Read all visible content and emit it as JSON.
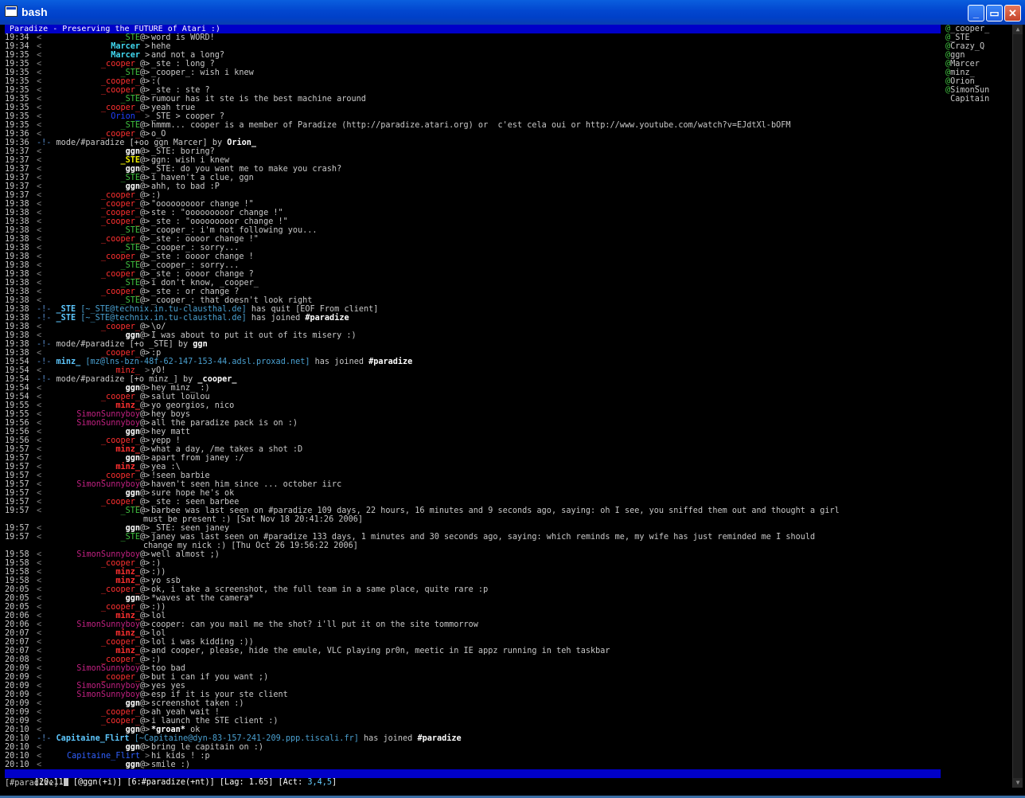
{
  "window": {
    "title": "bash",
    "minimize": "_",
    "maximize": "▭",
    "close": "✕"
  },
  "colors": {
    "titlebar": "#0348d0",
    "topic_bg": "#0000c8",
    "text": "#c8c8c8",
    "nick_red": "#ff3030",
    "nick_green": "#40c040",
    "nick_cyan": "#40d8f0",
    "nick_white": "#ffffff",
    "nick_yellow": "#f0f000",
    "nick_blue": "#3060ff",
    "nick_pink": "#c02080",
    "nick_orion": "#2040ff"
  },
  "topic": " Paradize - Preserving the FUTURE of Atari :)",
  "users": [
    {
      "prefix": "@",
      "name": "_cooper_"
    },
    {
      "prefix": "@",
      "name": "_STE"
    },
    {
      "prefix": "@",
      "name": "Crazy_Q"
    },
    {
      "prefix": "@",
      "name": "ggn"
    },
    {
      "prefix": "@",
      "name": "Marcer"
    },
    {
      "prefix": "@",
      "name": "minz_"
    },
    {
      "prefix": "@",
      "name": "Orion_"
    },
    {
      "prefix": "@",
      "name": "SimonSun"
    },
    {
      "prefix": " ",
      "name": "Capitain"
    }
  ],
  "lines": [
    {
      "t": "19:34",
      "nick": "_STE",
      "mode": "@",
      "color": "#40c040",
      "msg": "word is WORD!"
    },
    {
      "t": "19:34",
      "nick": "Marcer",
      "mode": " ",
      "color": "#40d8f0",
      "bold": true,
      "msg": "hehe"
    },
    {
      "t": "19:35",
      "nick": "Marcer",
      "mode": " ",
      "color": "#40d8f0",
      "bold": true,
      "msg": "and not a long?"
    },
    {
      "t": "19:35",
      "nick": "_cooper_",
      "mode": "@",
      "color": "#ff3030",
      "msg": "_ste : long ?"
    },
    {
      "t": "19:35",
      "nick": "_STE",
      "mode": "@",
      "color": "#40c040",
      "msg": "_cooper_: wish i knew"
    },
    {
      "t": "19:35",
      "nick": "_cooper_",
      "mode": "@",
      "color": "#ff3030",
      "msg": ":("
    },
    {
      "t": "19:35",
      "nick": "_cooper_",
      "mode": "@",
      "color": "#ff3030",
      "msg": "_ste : ste ?"
    },
    {
      "t": "19:35",
      "nick": "_STE",
      "mode": "@",
      "color": "#40c040",
      "msg": "rumour has it ste is the best machine around"
    },
    {
      "t": "19:35",
      "nick": "_cooper_",
      "mode": "@",
      "color": "#ff3030",
      "msg": "yeah true"
    },
    {
      "t": "19:35",
      "nick": "Orion_",
      "mode": " ",
      "color": "#2040ff",
      "gt": ">",
      "msg": "_STE > cooper ?"
    },
    {
      "t": "19:35",
      "nick": "_STE",
      "mode": "@",
      "color": "#40c040",
      "msg": "hmmm... cooper is a member of Paradize (http://paradize.atari.org) or  c'est cela oui or http://www.youtube.com/watch?v=EJdtXl-bOFM"
    },
    {
      "t": "19:36",
      "nick": "_cooper_",
      "mode": "@",
      "color": "#ff3030",
      "msg": "o_O"
    },
    {
      "t": "19:36",
      "kind": "mode",
      "text": "mode/#paradize [+oo ggn Marcer] by ",
      "by": "Orion_"
    },
    {
      "t": "19:37",
      "nick": "ggn",
      "mode": "@",
      "color": "#ffffff",
      "bold": true,
      "msg": "_STE: boring?"
    },
    {
      "t": "19:37",
      "nick": "_STE",
      "mode": "@",
      "color": "#f0f000",
      "bold": true,
      "msg": "ggn: wish i knew"
    },
    {
      "t": "19:37",
      "nick": "ggn",
      "mode": "@",
      "color": "#ffffff",
      "bold": true,
      "msg": "_STE: do you want me to make you crash?"
    },
    {
      "t": "19:37",
      "nick": "_STE",
      "mode": "@",
      "color": "#40c040",
      "msg": "i haven't a clue, ggn"
    },
    {
      "t": "19:37",
      "nick": "ggn",
      "mode": "@",
      "color": "#ffffff",
      "bold": true,
      "msg": "ahh, to bad :P"
    },
    {
      "t": "19:37",
      "nick": "_cooper_",
      "mode": "@",
      "color": "#ff3030",
      "msg": ":)"
    },
    {
      "t": "19:38",
      "nick": "_cooper_",
      "mode": "@",
      "color": "#ff3030",
      "msg": "\"ooooooooor change !\""
    },
    {
      "t": "19:38",
      "nick": "_cooper_",
      "mode": "@",
      "color": "#ff3030",
      "msg": "ste : \"ooooooooor change !\""
    },
    {
      "t": "19:38",
      "nick": "_cooper_",
      "mode": "@",
      "color": "#ff3030",
      "msg": "_ste : \"ooooooooor change !\""
    },
    {
      "t": "19:38",
      "nick": "_STE",
      "mode": "@",
      "color": "#40c040",
      "msg": "_cooper_: i'm not following you..."
    },
    {
      "t": "19:38",
      "nick": "_cooper_",
      "mode": "@",
      "color": "#ff3030",
      "msg": "_ste : oooor change !\""
    },
    {
      "t": "19:38",
      "nick": "_STE",
      "mode": "@",
      "color": "#40c040",
      "msg": "_cooper_: sorry..."
    },
    {
      "t": "19:38",
      "nick": "_cooper_",
      "mode": "@",
      "color": "#ff3030",
      "msg": "_ste : oooor change !"
    },
    {
      "t": "19:38",
      "nick": "_STE",
      "mode": "@",
      "color": "#40c040",
      "msg": "_cooper_: sorry..."
    },
    {
      "t": "19:38",
      "nick": "_cooper_",
      "mode": "@",
      "color": "#ff3030",
      "msg": "_ste : oooor change ?"
    },
    {
      "t": "19:38",
      "nick": "_STE",
      "mode": "@",
      "color": "#40c040",
      "msg": "i don't know, _cooper_"
    },
    {
      "t": "19:38",
      "nick": "_cooper_",
      "mode": "@",
      "color": "#ff3030",
      "msg": "_ste : or change ?"
    },
    {
      "t": "19:38",
      "nick": "_STE",
      "mode": "@",
      "color": "#40c040",
      "msg": "_cooper_: that doesn't look right"
    },
    {
      "t": "19:38",
      "kind": "quit",
      "who": "_STE",
      "host": "[~_STE@technix.in.tu-clausthal.de]",
      "text": " has quit [EOF From client]"
    },
    {
      "t": "19:38",
      "kind": "join",
      "who": "_STE",
      "host": "[~_STE@technix.in.tu-clausthal.de]",
      "text": " has joined ",
      "chan": "#paradize"
    },
    {
      "t": "19:38",
      "nick": "_cooper_",
      "mode": "@",
      "color": "#ff3030",
      "msg": "\\o/"
    },
    {
      "t": "19:38",
      "nick": "ggn",
      "mode": "@",
      "color": "#ffffff",
      "bold": true,
      "msg": "I was about to put it out of its misery :)"
    },
    {
      "t": "19:38",
      "kind": "mode",
      "text": "mode/#paradize [+o _STE] by ",
      "by": "ggn"
    },
    {
      "t": "19:38",
      "nick": "_cooper_",
      "mode": "@",
      "color": "#ff3030",
      "msg": ":p"
    },
    {
      "t": "19:54",
      "kind": "join",
      "who": "minz_",
      "host": "[mz@lns-bzn-48f-62-147-153-44.adsl.proxad.net]",
      "text": " has joined ",
      "chan": "#paradize"
    },
    {
      "t": "19:54",
      "nick": "minz_",
      "mode": " ",
      "color": "#ff3030",
      "gt": ">",
      "msg": "yO!"
    },
    {
      "t": "19:54",
      "kind": "mode",
      "text": "mode/#paradize [+o minz_] by ",
      "by": "_cooper_"
    },
    {
      "t": "19:54",
      "nick": "ggn",
      "mode": "@",
      "color": "#ffffff",
      "bold": true,
      "msg": "hey minz_ :)"
    },
    {
      "t": "19:54",
      "nick": "_cooper_",
      "mode": "@",
      "color": "#ff3030",
      "msg": "salut loulou"
    },
    {
      "t": "19:55",
      "nick": "minz_",
      "mode": "@",
      "color": "#ff3030",
      "bold": true,
      "msg": "yo georgios, nico"
    },
    {
      "t": "19:55",
      "nick": "SimonSunnyboy",
      "mode": "@",
      "color": "#c02080",
      "msg": "hey boys"
    },
    {
      "t": "19:56",
      "nick": "SimonSunnyboy",
      "mode": "@",
      "color": "#c02080",
      "msg": "all the paradize pack is on :)"
    },
    {
      "t": "19:56",
      "nick": "ggn",
      "mode": "@",
      "color": "#ffffff",
      "bold": true,
      "msg": "hey matt"
    },
    {
      "t": "19:56",
      "nick": "_cooper_",
      "mode": "@",
      "color": "#ff3030",
      "msg": "yepp !"
    },
    {
      "t": "19:57",
      "nick": "minz_",
      "mode": "@",
      "color": "#ff3030",
      "bold": true,
      "msg": "what a day, /me takes a shot :D"
    },
    {
      "t": "19:57",
      "nick": "ggn",
      "mode": "@",
      "color": "#ffffff",
      "bold": true,
      "msg": "apart from janey :/"
    },
    {
      "t": "19:57",
      "nick": "minz_",
      "mode": "@",
      "color": "#ff3030",
      "bold": true,
      "msg": "yea :\\"
    },
    {
      "t": "19:57",
      "nick": "_cooper_",
      "mode": "@",
      "color": "#ff3030",
      "msg": "!seen barbie"
    },
    {
      "t": "19:57",
      "nick": "SimonSunnyboy",
      "mode": "@",
      "color": "#c02080",
      "msg": "haven't seen him since ... october iirc"
    },
    {
      "t": "19:57",
      "nick": "ggn",
      "mode": "@",
      "color": "#ffffff",
      "bold": true,
      "msg": "sure hope he's ok"
    },
    {
      "t": "19:57",
      "nick": "_cooper_",
      "mode": "@",
      "color": "#ff3030",
      "msg": "_ste : seen barbee"
    },
    {
      "t": "19:57",
      "nick": "_STE",
      "mode": "@",
      "color": "#40c040",
      "msg": "barbee was last seen on #paradize 109 days, 22 hours, 16 minutes and 9 seconds ago, saying: oh I see, you sniffed them out and thought a girl"
    },
    {
      "kind": "cont",
      "msg": "must be present :) [Sat Nov 18 20:41:26 2006]"
    },
    {
      "t": "19:57",
      "nick": "ggn",
      "mode": "@",
      "color": "#ffffff",
      "bold": true,
      "msg": "_STE: seen janey"
    },
    {
      "t": "19:57",
      "nick": "_STE",
      "mode": "@",
      "color": "#40c040",
      "msg": "janey was last seen on #paradize 133 days, 1 minutes and 30 seconds ago, saying: which reminds me, my wife has just reminded me I should"
    },
    {
      "kind": "cont",
      "msg": "change my nick :) [Thu Oct 26 19:56:22 2006]"
    },
    {
      "t": "19:58",
      "nick": "SimonSunnyboy",
      "mode": "@",
      "color": "#c02080",
      "msg": "well almost ;)"
    },
    {
      "t": "19:58",
      "nick": "_cooper_",
      "mode": "@",
      "color": "#ff3030",
      "msg": ":)"
    },
    {
      "t": "19:58",
      "nick": "minz_",
      "mode": "@",
      "color": "#ff3030",
      "bold": true,
      "msg": ":))"
    },
    {
      "t": "19:58",
      "nick": "minz_",
      "mode": "@",
      "color": "#ff3030",
      "bold": true,
      "msg": "yo ssb"
    },
    {
      "t": "20:05",
      "nick": "_cooper_",
      "mode": "@",
      "color": "#ff3030",
      "msg": "ok, i take a screenshot, the full team in a same place, quite rare :p"
    },
    {
      "t": "20:05",
      "nick": "ggn",
      "mode": "@",
      "color": "#ffffff",
      "bold": true,
      "msg": "*waves at the camera*"
    },
    {
      "t": "20:05",
      "nick": "_cooper_",
      "mode": "@",
      "color": "#ff3030",
      "msg": ":))"
    },
    {
      "t": "20:06",
      "nick": "minz_",
      "mode": "@",
      "color": "#ff3030",
      "bold": true,
      "msg": "lol"
    },
    {
      "t": "20:06",
      "nick": "SimonSunnyboy",
      "mode": "@",
      "color": "#c02080",
      "msg": "cooper: can you mail me the shot? i'll put it on the site tommorrow"
    },
    {
      "t": "20:07",
      "nick": "minz_",
      "mode": "@",
      "color": "#ff3030",
      "bold": true,
      "msg": "lol"
    },
    {
      "t": "20:07",
      "nick": "_cooper_",
      "mode": "@",
      "color": "#ff3030",
      "msg": "lol i was kidding :))"
    },
    {
      "t": "20:07",
      "nick": "minz_",
      "mode": "@",
      "color": "#ff3030",
      "bold": true,
      "msg": "and cooper, please, hide the emule, VLC playing pr0n, meetic in IE appz running in teh taskbar"
    },
    {
      "t": "20:08",
      "nick": "_cooper_",
      "mode": "@",
      "color": "#ff3030",
      "msg": ":)"
    },
    {
      "t": "20:09",
      "nick": "SimonSunnyboy",
      "mode": "@",
      "color": "#c02080",
      "msg": "too bad"
    },
    {
      "t": "20:09",
      "nick": "_cooper_",
      "mode": "@",
      "color": "#ff3030",
      "msg": "but i can if you want ;)"
    },
    {
      "t": "20:09",
      "nick": "SimonSunnyboy",
      "mode": "@",
      "color": "#c02080",
      "msg": "yes yes"
    },
    {
      "t": "20:09",
      "nick": "SimonSunnyboy",
      "mode": "@",
      "color": "#c02080",
      "msg": "esp if it is your ste client"
    },
    {
      "t": "20:09",
      "nick": "ggn",
      "mode": "@",
      "color": "#ffffff",
      "bold": true,
      "msg": "screenshot taken :)"
    },
    {
      "t": "20:09",
      "nick": "_cooper_",
      "mode": "@",
      "color": "#ff3030",
      "msg": "ah yeah wait !"
    },
    {
      "t": "20:09",
      "nick": "_cooper_",
      "mode": "@",
      "color": "#ff3030",
      "msg": "i launch the STE client :)"
    },
    {
      "t": "20:10",
      "nick": "ggn",
      "mode": "@",
      "color": "#ffffff",
      "bold": true,
      "msg": "*groan* ok",
      "msgBoldPart": "*groan*"
    },
    {
      "t": "20:10",
      "kind": "join",
      "who": "Capitaine_Flirt",
      "host": "[~Capitaine@dyn-83-157-241-209.ppp.tiscali.fr]",
      "text": " has joined ",
      "chan": "#paradize"
    },
    {
      "t": "20:10",
      "nick": "ggn",
      "mode": "@",
      "color": "#ffffff",
      "bold": true,
      "msg": "bring le capitain on :)"
    },
    {
      "t": "20:10",
      "nick": "Capitaine_Flirt",
      "mode": " ",
      "color": "#3060ff",
      "lt": "<",
      "gt": ">",
      "msg": "hi kids ! :p"
    },
    {
      "t": "20:10",
      "nick": "ggn",
      "mode": "@",
      "color": "#ffffff",
      "bold": true,
      "msg": "smile :)"
    }
  ],
  "status": {
    "time": "[20:11]",
    "nick": "[@ggn(+i)]",
    "window": "[6:#paradize(+nt)]",
    "lag": "[Lag: 1.65]",
    "act_prefix": "[Act: ",
    "act_values": "3,4,5",
    "act_suffix": "]"
  },
  "input": {
    "prompt": "[#paradize] "
  }
}
